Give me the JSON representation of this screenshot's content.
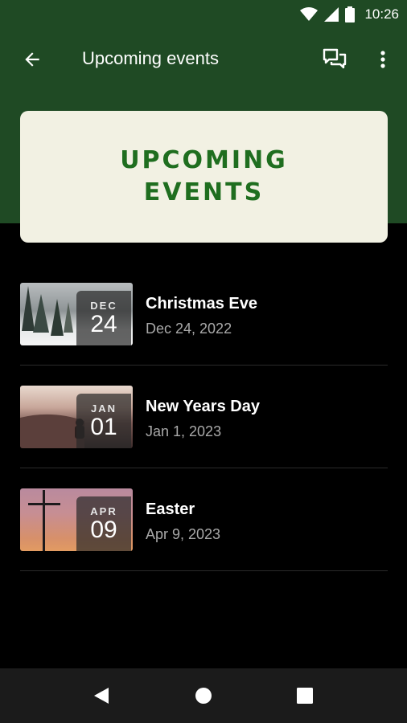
{
  "status_bar": {
    "time": "10:26",
    "icons": [
      "wifi-icon",
      "signal-icon",
      "battery-icon"
    ]
  },
  "app_bar": {
    "title": "Upcoming events",
    "back_icon": "arrow-left-icon",
    "chat_icon": "chat-icon",
    "menu_icon": "more-vertical-icon"
  },
  "banner": {
    "line1": "UPCOMING",
    "line2": "EVENTS"
  },
  "events": [
    {
      "month": "DEC",
      "day": "24",
      "title": "Christmas Eve",
      "date": "Dec 24, 2022"
    },
    {
      "month": "JAN",
      "day": "01",
      "title": "New Years Day",
      "date": "Jan 1, 2023"
    },
    {
      "month": "APR",
      "day": "09",
      "title": "Easter",
      "date": "Apr 9, 2023"
    }
  ],
  "nav_bar": {
    "icons": [
      "back-triangle-icon",
      "home-circle-icon",
      "recents-square-icon"
    ]
  },
  "colors": {
    "header_green": "#1f4a24",
    "banner_bg": "#f2f1e3",
    "banner_text": "#1f6e1f",
    "secondary_text": "#a9a9a9"
  }
}
